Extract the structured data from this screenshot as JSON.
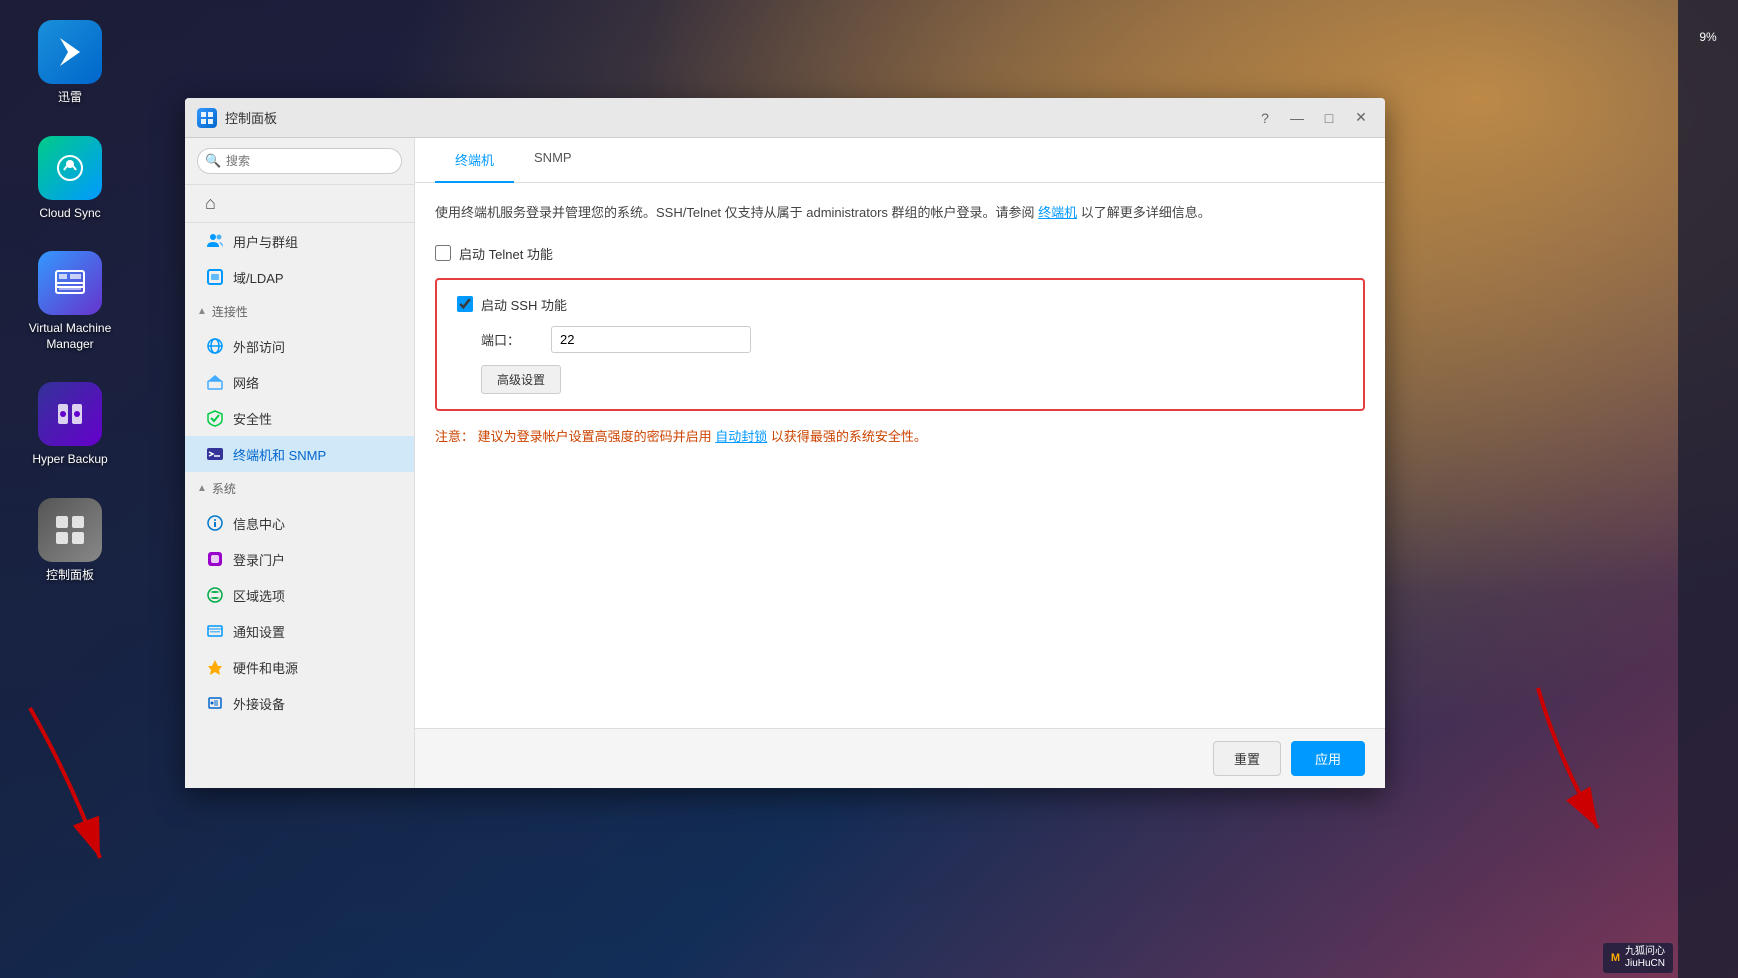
{
  "desktop": {
    "background_note": "gradient dark blue to orange"
  },
  "taskbar_right": {
    "progress_label": "9%"
  },
  "desktop_icons": [
    {
      "id": "xunlei",
      "label": "迅雷",
      "color_start": "#1a90d9",
      "color_end": "#0066cc"
    },
    {
      "id": "cloud-sync",
      "label": "Cloud Sync",
      "color_start": "#00cc88",
      "color_end": "#0099ff"
    },
    {
      "id": "virtual-machine-manager",
      "label": "Virtual Machine\nManager",
      "color_start": "#3399ff",
      "color_end": "#6633cc"
    },
    {
      "id": "hyper-backup",
      "label": "Hyper Backup",
      "color_start": "#333399",
      "color_end": "#6600cc"
    },
    {
      "id": "control-panel",
      "label": "控制面板",
      "color_start": "#555555",
      "color_end": "#888888"
    }
  ],
  "window": {
    "title": "控制面板",
    "title_icon": "⚙",
    "controls": {
      "help": "?",
      "minimize": "—",
      "maximize": "□",
      "close": "✕"
    }
  },
  "sidebar": {
    "search_placeholder": "搜索",
    "home_icon": "⌂",
    "sections": [
      {
        "header": "连接性",
        "collapsible": true,
        "items": [
          {
            "label": "外部访问",
            "icon": "🌐",
            "icon_color": "#0099ff"
          },
          {
            "label": "网络",
            "icon": "🏠",
            "icon_color": "#44aaff"
          },
          {
            "label": "安全性",
            "icon": "✅",
            "icon_color": "#00cc44"
          },
          {
            "label": "终端机和 SNMP",
            "icon": "▶",
            "icon_color": "#333399",
            "active": true
          }
        ]
      },
      {
        "header": "系统",
        "collapsible": true,
        "items": [
          {
            "label": "信息中心",
            "icon": "ℹ",
            "icon_color": "#0077cc"
          },
          {
            "label": "登录门户",
            "icon": "🔷",
            "icon_color": "#9900cc"
          },
          {
            "label": "区域选项",
            "icon": "🌿",
            "icon_color": "#00aa44"
          },
          {
            "label": "通知设置",
            "icon": "📋",
            "icon_color": "#0099ff"
          },
          {
            "label": "硬件和电源",
            "icon": "⚡",
            "icon_color": "#ffaa00"
          },
          {
            "label": "外接设备",
            "icon": "💾",
            "icon_color": "#0066cc"
          }
        ]
      }
    ],
    "top_items": [
      {
        "label": "用户与群组",
        "icon": "👥",
        "icon_color": "#0099ff"
      },
      {
        "label": "域/LDAP",
        "icon": "🏢",
        "icon_color": "#0099ff"
      }
    ]
  },
  "main": {
    "tabs": [
      {
        "label": "终端机",
        "active": true
      },
      {
        "label": "SNMP",
        "active": false
      }
    ],
    "description": "使用终端机服务登录并管理您的系统。SSH/Telnet 仅支持从属于 administrators 群组的帐户登录。请参阅 终端机 以了解更多详细信息。",
    "description_link": "终端机",
    "telnet_checkbox": {
      "label": "启动 Telnet 功能",
      "checked": false
    },
    "ssh_section": {
      "checkbox": {
        "label": "启动 SSH 功能",
        "checked": true
      },
      "port_label": "端口：",
      "port_value": "22",
      "advanced_btn_label": "高级设置"
    },
    "warning": {
      "prefix": "注意：",
      "text": " 建议为登录帐户设置高强度的密码并启用 ",
      "link_text": "自动封锁",
      "suffix": " 以获得最强的系统安全性。"
    },
    "bottom": {
      "reset_label": "重置",
      "apply_label": "应用"
    }
  },
  "watermark": {
    "icon": "M",
    "text": "九狐问心\nJiuHuCN"
  }
}
